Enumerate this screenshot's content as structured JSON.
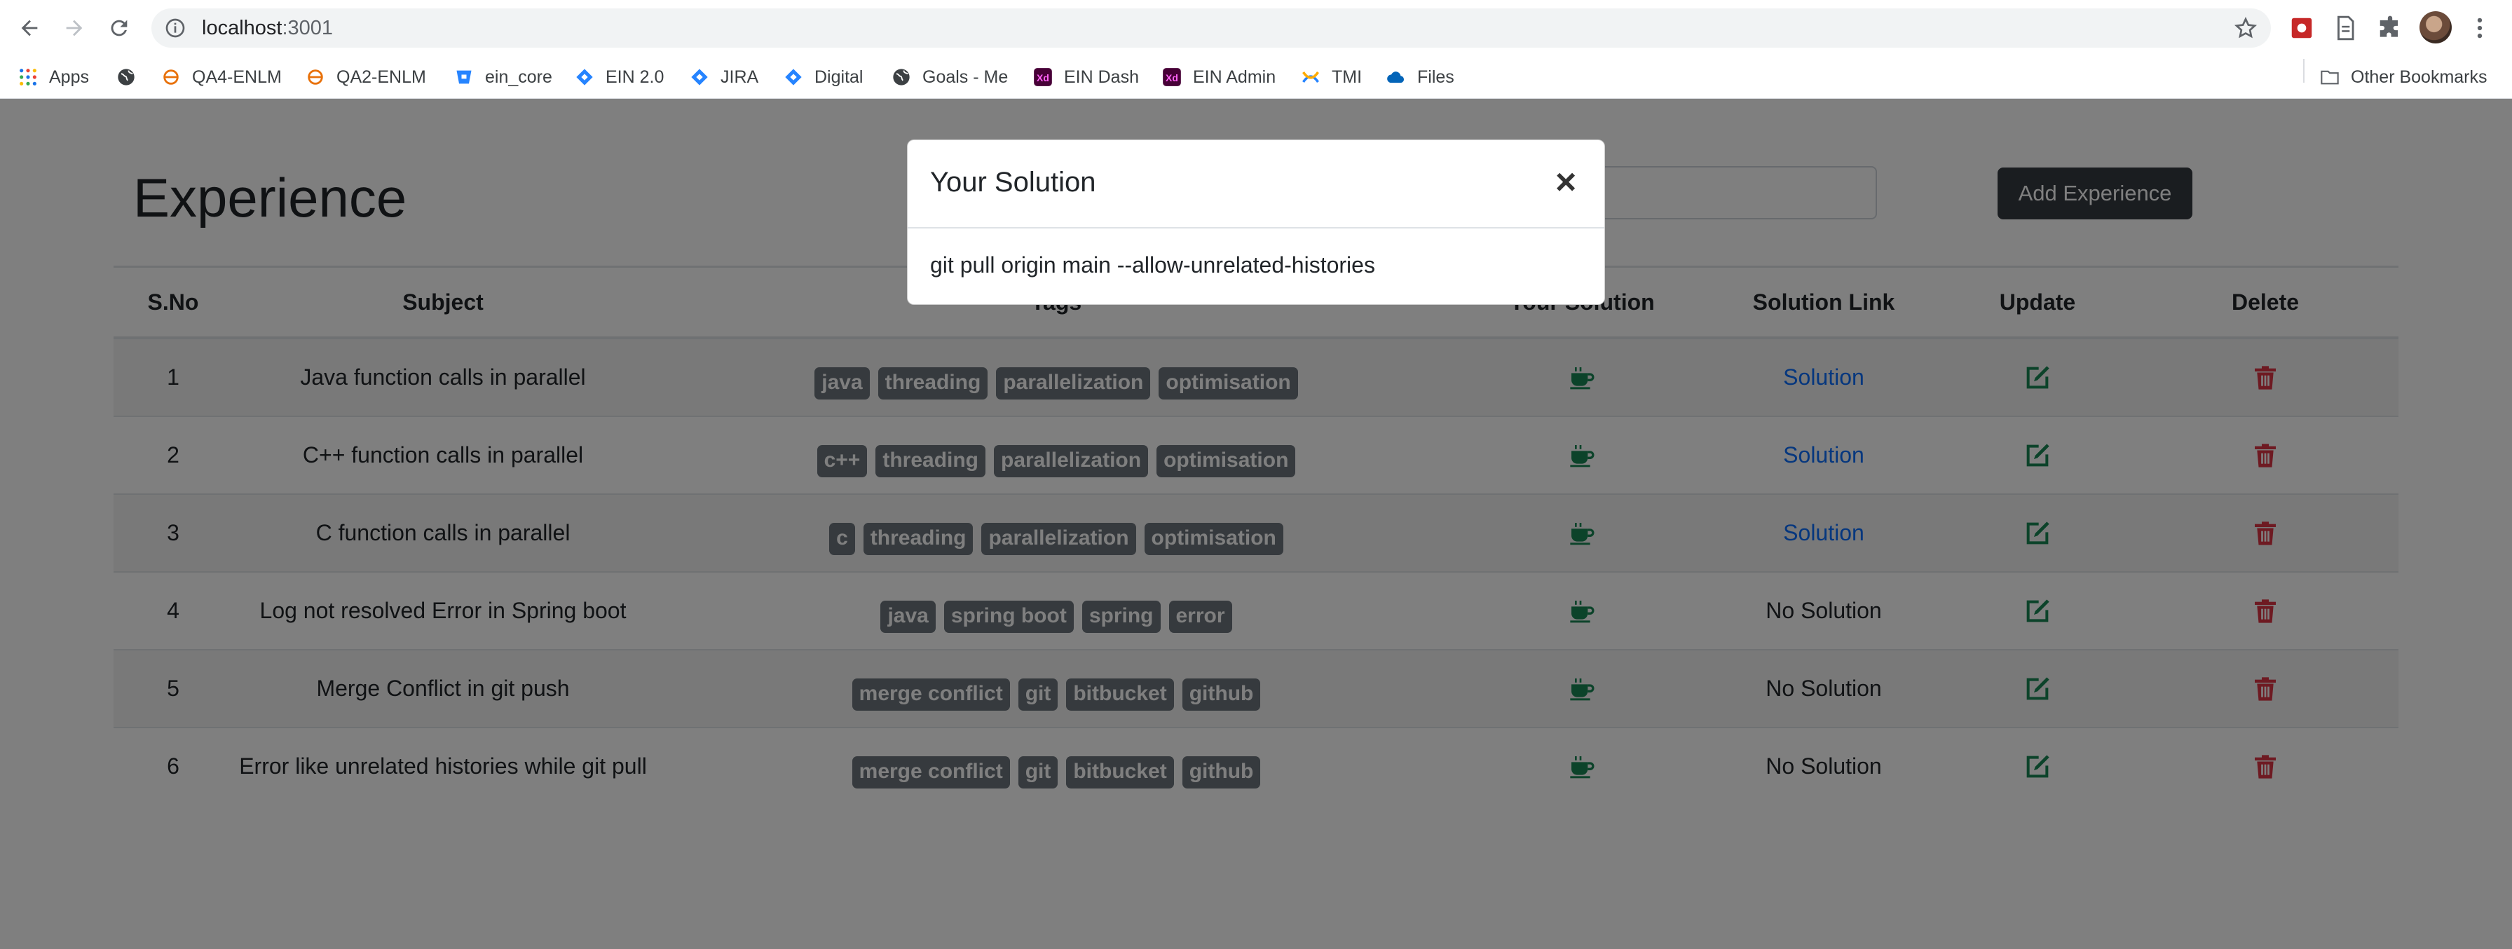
{
  "browser": {
    "url_host": "localhost",
    "url_port": ":3001",
    "apps_label": "Apps",
    "bookmarks": [
      {
        "label": "QA4-ENLM",
        "icon": "orbit-icon"
      },
      {
        "label": "QA2-ENLM",
        "icon": "orbit-icon"
      },
      {
        "label": "ein_core",
        "icon": "bitbucket-icon"
      },
      {
        "label": "EIN 2.0",
        "icon": "jira-icon"
      },
      {
        "label": "JIRA",
        "icon": "jira-icon"
      },
      {
        "label": "Digital",
        "icon": "jira-icon"
      },
      {
        "label": "Goals - Me",
        "icon": "globe-icon"
      },
      {
        "label": "EIN Dash",
        "icon": "xd-icon"
      },
      {
        "label": "EIN Admin",
        "icon": "xd-icon"
      },
      {
        "label": "TMI",
        "icon": "confluence-icon"
      },
      {
        "label": "Files",
        "icon": "cloud-icon"
      }
    ],
    "other_bookmarks": "Other Bookmarks"
  },
  "page": {
    "title": "Experience",
    "add_button": "Add Experience",
    "columns": [
      "S.No",
      "Subject",
      "Tags",
      "Your Solution",
      "Solution Link",
      "Update",
      "Delete"
    ],
    "rows": [
      {
        "sno": "1",
        "subject": "Java function calls in parallel",
        "tags": [
          "java",
          "threading",
          "parallelization",
          "optimisation"
        ],
        "link": "Solution"
      },
      {
        "sno": "2",
        "subject": "C++ function calls in parallel",
        "tags": [
          "c++",
          "threading",
          "parallelization",
          "optimisation"
        ],
        "link": "Solution"
      },
      {
        "sno": "3",
        "subject": "C function calls in parallel",
        "tags": [
          "c",
          "threading",
          "parallelization",
          "optimisation"
        ],
        "link": "Solution"
      },
      {
        "sno": "4",
        "subject": "Log not resolved Error in Spring boot",
        "tags": [
          "java",
          "spring boot",
          "spring",
          "error"
        ],
        "link": "No Solution"
      },
      {
        "sno": "5",
        "subject": "Merge Conflict in git push",
        "tags": [
          "merge conflict",
          "git",
          "bitbucket",
          "github"
        ],
        "link": "No Solution"
      },
      {
        "sno": "6",
        "subject": "Error like unrelated histories while git pull",
        "tags": [
          "merge conflict",
          "git",
          "bitbucket",
          "github"
        ],
        "link": "No Solution"
      }
    ]
  },
  "modal": {
    "title": "Your Solution",
    "close": "×",
    "body": "git pull origin main --allow-unrelated-histories"
  },
  "colors": {
    "primary_dark": "#343a40",
    "tag_bg": "#6c757d",
    "link": "#0d6efd",
    "success_icon": "#198754",
    "danger_icon": "#dc3545"
  }
}
